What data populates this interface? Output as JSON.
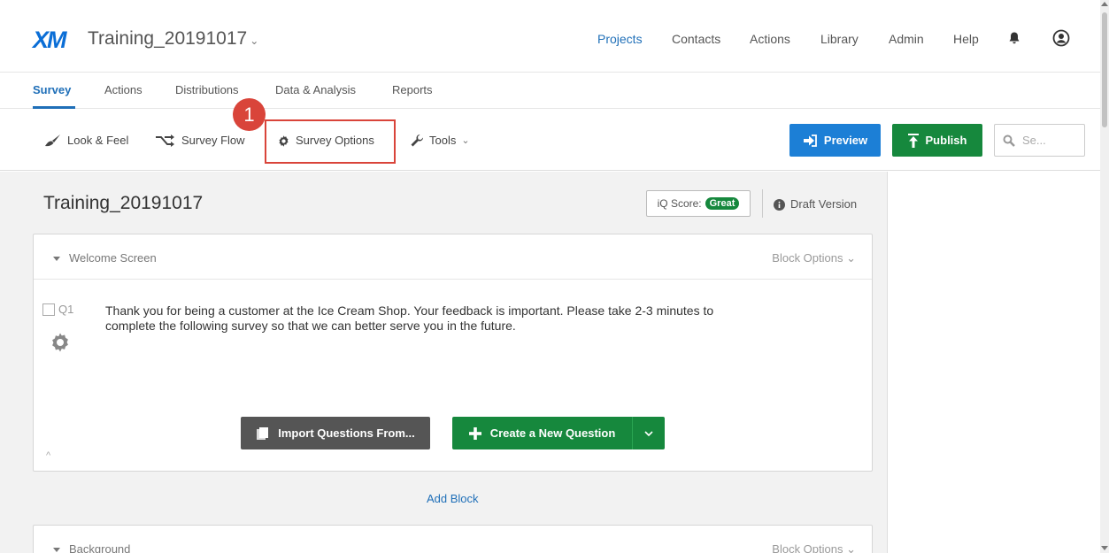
{
  "app": {
    "logo": "XM",
    "project_title": "Training_20191017",
    "project_chevron": "⌄",
    "top_menu": [
      "Projects",
      "Contacts",
      "Actions",
      "Library",
      "Admin",
      "Help"
    ],
    "active_top_menu": "Projects"
  },
  "tabs": {
    "items": [
      "Survey",
      "Actions",
      "Distributions",
      "Data & Analysis",
      "Reports"
    ],
    "active": "Survey"
  },
  "annotation": {
    "badge_number": "1",
    "color": "#d9443a"
  },
  "toolbar": {
    "look_feel": "Look & Feel",
    "survey_flow": "Survey Flow",
    "survey_options": "Survey Options",
    "tools": "Tools",
    "tools_chevron": "⌄",
    "preview": "Preview",
    "publish": "Publish",
    "search_placeholder": "Se..."
  },
  "survey": {
    "title": "Training_20191017",
    "iq_label": "iQ Score:",
    "iq_value": "Great",
    "draft": "Draft Version"
  },
  "blocks": [
    {
      "name": "Welcome Screen",
      "options": "Block Options ⌄",
      "question": {
        "number": "Q1",
        "text": "Thank you for being a customer at the Ice Cream Shop. Your feedback is important. Please take 2-3 minutes to complete the following survey so that we can better serve you in the future."
      },
      "import_label": "Import Questions From...",
      "create_label": "Create a New Question",
      "collapse_glyph": "^"
    },
    {
      "name": "Background",
      "options": "Block Options ⌄"
    }
  ],
  "add_block": "Add Block",
  "colors": {
    "brand_blue": "#1c7fd6",
    "link_blue": "#1f6fb8",
    "publish_green": "#16883d",
    "dark_button": "#555555"
  }
}
